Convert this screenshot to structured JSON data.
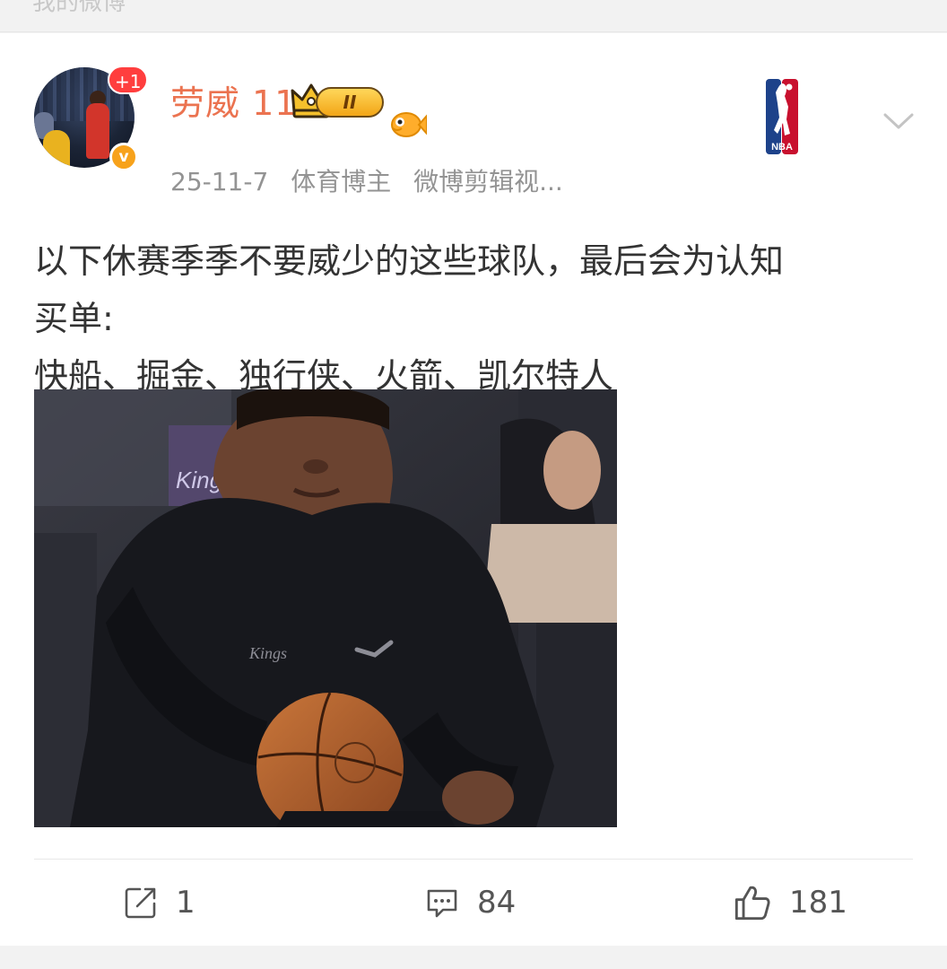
{
  "top_strip": {
    "cut_text": "我的微博"
  },
  "post": {
    "avatar": {
      "badge": "+1",
      "verified_mark": "v"
    },
    "username": "劳威 11",
    "level_badge": "II",
    "meta": {
      "date": "25-11-7",
      "role": "体育博主",
      "source": "微博剪辑视..."
    },
    "text_lines": [
      "以下休赛季季不要威少的这些球队，最后会为认知",
      "买单:",
      "快船、掘金、独行侠、火箭、凯尔特人"
    ],
    "nba_logo_text": "NBA",
    "image": {
      "jersey_text": "Kings",
      "crowd_text": "Kings"
    }
  },
  "actions": {
    "repost_count": "1",
    "comment_count": "84",
    "like_count": "181"
  },
  "colors": {
    "username": "#eb7350",
    "meta": "#939393",
    "text": "#333333",
    "badge": "#ff3e3e",
    "verified": "#f7a21b"
  },
  "icons": [
    "crown-icon",
    "level-badge",
    "fish-icon",
    "nba-logo",
    "chevron-down-icon",
    "repost-icon",
    "comment-icon",
    "like-icon"
  ]
}
